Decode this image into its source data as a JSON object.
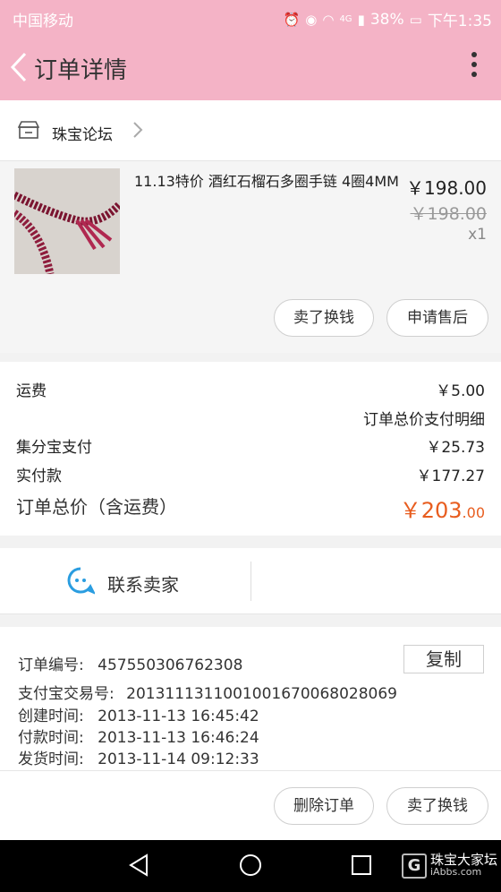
{
  "status_bar": {
    "carrier": "中国移动",
    "battery": "38%",
    "network": "4G",
    "time": "下午1:35"
  },
  "header": {
    "title": "订单详情",
    "back_icon": "chevron-left-icon",
    "more_icon": "more-vertical-icon"
  },
  "shop": {
    "icon": "store-icon",
    "name": "珠宝论坛"
  },
  "item": {
    "title": "11.13特价 酒红石榴石多圈手链 4圈4MM",
    "price": "￥198.00",
    "original_price": "￥198.00",
    "quantity": "x1",
    "buttons": [
      "卖了换钱",
      "申请售后"
    ]
  },
  "summary": {
    "shipping_label": "运费",
    "shipping_value": "￥5.00",
    "detail_link": "订单总价支付明细",
    "jifenbao_label": "集分宝支付",
    "jifenbao_value": "￥25.73",
    "paid_label": "实付款",
    "paid_value": "￥177.27",
    "total_label": "订单总价（含运费）",
    "total_value_main": "￥203",
    "total_value_cents": ".00",
    "accent_color": "#e85d1f"
  },
  "contact": {
    "icon": "chat-bubble-icon",
    "label": "联系卖家"
  },
  "order_info": {
    "order_no_label": "订单编号:",
    "order_no": "457550306762308",
    "copy_label": "复制",
    "alipay_label": "支付宝交易号:",
    "alipay_no": "2013111311001001670068028069",
    "created_label": "创建时间:",
    "created": "2013-11-13 16:45:42",
    "paid_label": "付款时间:",
    "paid": "2013-11-13 16:46:24",
    "shipped_label": "发货时间:",
    "shipped": "2013-11-14 09:12:33"
  },
  "actions": [
    "删除订单",
    "卖了换钱"
  ],
  "watermark": {
    "letter": "G",
    "text": "珠宝大家坛",
    "sub": "iAbbs.com"
  }
}
